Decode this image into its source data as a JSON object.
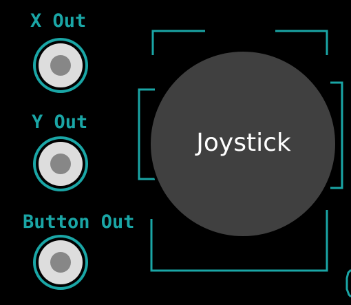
{
  "colors": {
    "background": "#000000",
    "accent": "#1aa6a6",
    "jack_silver": "#dddddd",
    "jack_hole": "#878787",
    "knob": "#404040",
    "knob_text": "#ffffff"
  },
  "outputs": [
    {
      "label": "X Out"
    },
    {
      "label": "Y Out"
    },
    {
      "label": "Button Out"
    }
  ],
  "joystick": {
    "label": "Joystick"
  }
}
